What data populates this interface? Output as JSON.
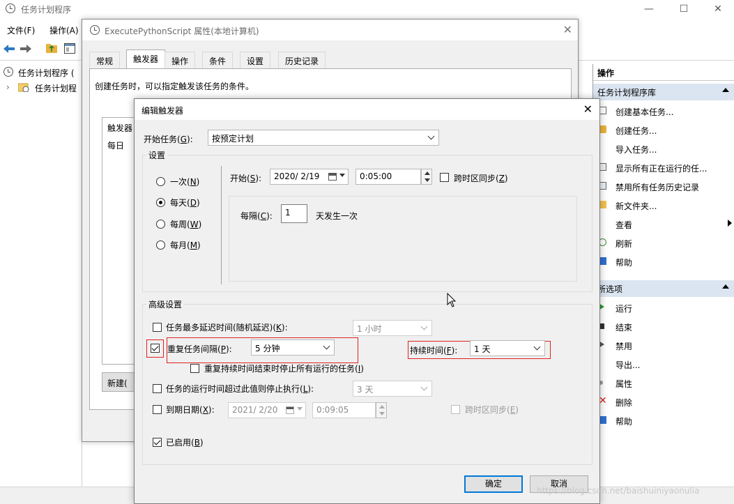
{
  "main_window": {
    "title": "任务计划程序",
    "controls": {
      "minimize": "—",
      "maximize": "☐",
      "close": "✕"
    },
    "menu": [
      "文件(F)",
      "操作(A)"
    ],
    "tree": {
      "root": "任务计划程序 (",
      "child": "任务计划程"
    }
  },
  "actions_panel": {
    "header": "操作",
    "section1": {
      "title": "任务计划程序库",
      "items": [
        "创建基本任务...",
        "创建任务...",
        "导入任务...",
        "显示所有正在运行的任...",
        "禁用所有任务历史记录",
        "新文件夹...",
        "查看",
        "刷新",
        "帮助"
      ]
    },
    "section2": {
      "title": "所选项",
      "items": [
        "运行",
        "结束",
        "禁用",
        "导出...",
        "属性",
        "删除",
        "帮助"
      ]
    }
  },
  "properties_dialog": {
    "title": "ExecutePythonScript 属性(本地计算机)",
    "close": "✕",
    "tabs": [
      "常规",
      "触发器",
      "操作",
      "条件",
      "设置",
      "历史记录"
    ],
    "active_tab": "触发器",
    "description": "创建任务时，可以指定触发该任务的条件。",
    "list_header": "触发器",
    "list_row": "每日",
    "new_button": "新建("
  },
  "edit_trigger": {
    "title": "编辑触发器",
    "close": "✕",
    "start_task_label": "开始任务(",
    "start_task_key": "G",
    "start_task_suffix": "):",
    "start_task_value": "按预定计划",
    "settings_label": "设置",
    "radios": [
      {
        "label": "一次(",
        "key": "N",
        "checked": false
      },
      {
        "label": "每天(",
        "key": "D",
        "checked": true
      },
      {
        "label": "每周(",
        "key": "W",
        "checked": false
      },
      {
        "label": "每月(",
        "key": "M",
        "checked": false
      }
    ],
    "start_label": "开始(",
    "start_key": "S",
    "start_date": "2020/  2/19",
    "start_time": "0:05:00",
    "sync_tz_label": "跨时区同步(",
    "sync_tz_key": "Z",
    "every_label": "每隔(",
    "every_key": "C",
    "every_value": "1",
    "every_suffix": "天发生一次",
    "advanced_label": "高级设置",
    "max_delay_label": "任务最多延迟时间(随机延迟)(",
    "max_delay_key": "K",
    "max_delay_value": "1 小时",
    "repeat_label": "重复任务间隔(",
    "repeat_key": "P",
    "repeat_value": "5 分钟",
    "duration_label": "持续时间(",
    "duration_key": "F",
    "duration_value": "1 天",
    "stop_running_label": "重复持续时间结束时停止所有运行的任务(",
    "stop_running_key": "I",
    "stop_exceed_label": "任务的运行时间超过此值则停止执行(",
    "stop_exceed_key": "L",
    "stop_exceed_value": "3 天",
    "expire_label": "到期日期(",
    "expire_key": "X",
    "expire_date": "2021/  2/20",
    "expire_time": "0:09:05",
    "expire_sync_label": "跨时区同步(",
    "expire_sync_key": "E",
    "enabled_label": "已启用(",
    "enabled_key": "B",
    "ok": "确定",
    "cancel": "取消"
  },
  "watermark": "https://blog.csdn.net/baishuiniyaonulia"
}
